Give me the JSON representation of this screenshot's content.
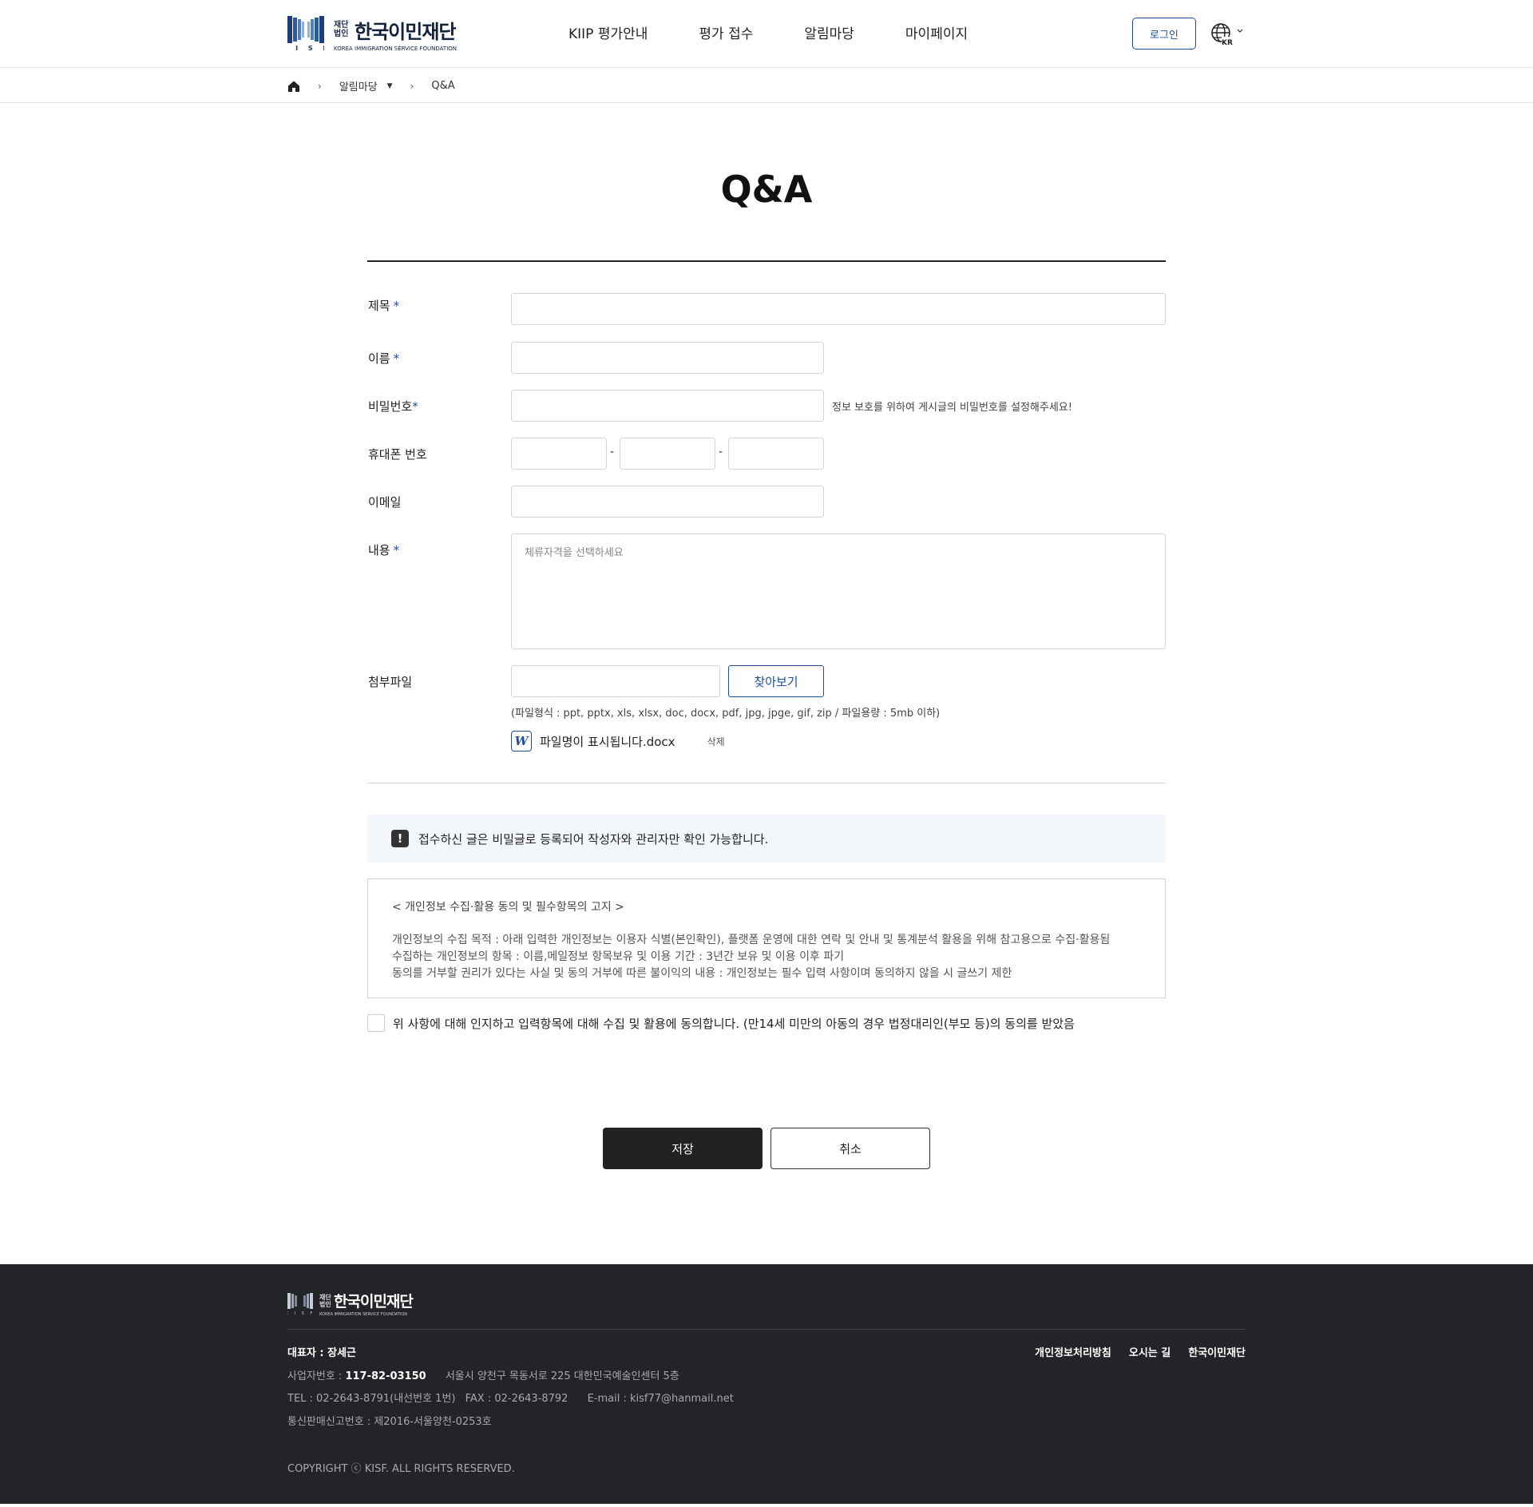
{
  "header": {
    "logo": {
      "small_top": "재단",
      "small_bottom": "법인",
      "name": "한국이민재단",
      "english": "KOREA IMMIGRATION SERVICE FOUNDATION",
      "mark_letters": "K I S F",
      "colors": {
        "navy": "#1c3f7c",
        "blue": "#4b7fc9"
      }
    },
    "nav": [
      "KIIP 평가안내",
      "평가 접수",
      "알림마당",
      "마이페이지"
    ],
    "login_label": "로그인",
    "lang_label": "KR"
  },
  "breadcrumb": {
    "home_icon": "home-icon",
    "section": "알림마당",
    "current": "Q&A"
  },
  "page_title": "Q&A",
  "form": {
    "title_label": "제목",
    "name_label": "이름",
    "password_label": "비밀번호",
    "password_hint": "정보 보호를 위하여 게시글의 비밀번호를 설정해주세요!",
    "phone_label": "휴대폰 번호",
    "phone_dash": "-",
    "email_label": "이메일",
    "content_label": "내용",
    "content_placeholder": "체류자격을 선택하세요",
    "attach_label": "첨부파일",
    "find_button": "찾아보기",
    "file_info": "(파일형식 : ppt, pptx, xls, xlsx, doc, docx, pdf, jpg, jpge, gif, zip / 파일용량 : 5mb 이하)",
    "file_icon_letter": "W",
    "file_name": "파일명이 표시됩니다.docx",
    "file_delete": "삭제",
    "required_mark": "*"
  },
  "notice": {
    "icon": "!",
    "text": "접수하신 글은 비밀글로 등록되어 작성자와 관리자만 확인 가능합니다."
  },
  "privacy": {
    "title": "< 개인정보 수집·활용 동의 및 필수항목의 고지 >",
    "lines": [
      "개인정보의 수집 목적 : 아래 입력한 개인정보는 이용자 식별(본인확인), 플랫폼 운영에 대한 연락 및 안내 및 통계분석 활용을 위해 참고용으로 수집·활용됨",
      "수집하는 개인정보의 항목 : 이름,메일정보 항목보유 및 이용 기간 : 3년간 보유 및 이용 이후 파기",
      "동의를 거부할 권리가 있다는 사실 및 동의 거부에 따른 불이익의 내용 : 개인정보는 필수 입력 사항이며 동의하지 않을 시 글쓰기 제한"
    ]
  },
  "agree_text": "위 사항에 대해 인지하고 입력항목에 대해 수집 및 활용에 동의합니다. (만14세 미만의 아동의 경우 법정대리인(부모 등)의 동의를 받았음",
  "buttons": {
    "save": "저장",
    "cancel": "취소"
  },
  "footer": {
    "logo": {
      "small_top": "재단",
      "small_bottom": "법인",
      "name": "한국이민재단",
      "english": "KOREA IMMIGRATION SERVICE FOUNDATION"
    },
    "representative": "대표자 : 장세근",
    "links": [
      "개인정보처리방침",
      "오시는 길",
      "한국이민재단"
    ],
    "biz_label": "사업자번호 : ",
    "biz_number": "117-82-03150",
    "address": "서울시 양천구 목동서로 225 대한민국예술인센터 5층",
    "tel": "TEL : 02-2643-8791(내선번호 1번)",
    "fax": "FAX : 02-2643-8792",
    "email": "E-mail : kisf77@hanmail.net",
    "mail_order": "통신판매신고번호 : 제2016-서울양천-0253호",
    "copyright": "COPYRIGHT ⓒ KISF. ALL RIGHTS RESERVED."
  }
}
